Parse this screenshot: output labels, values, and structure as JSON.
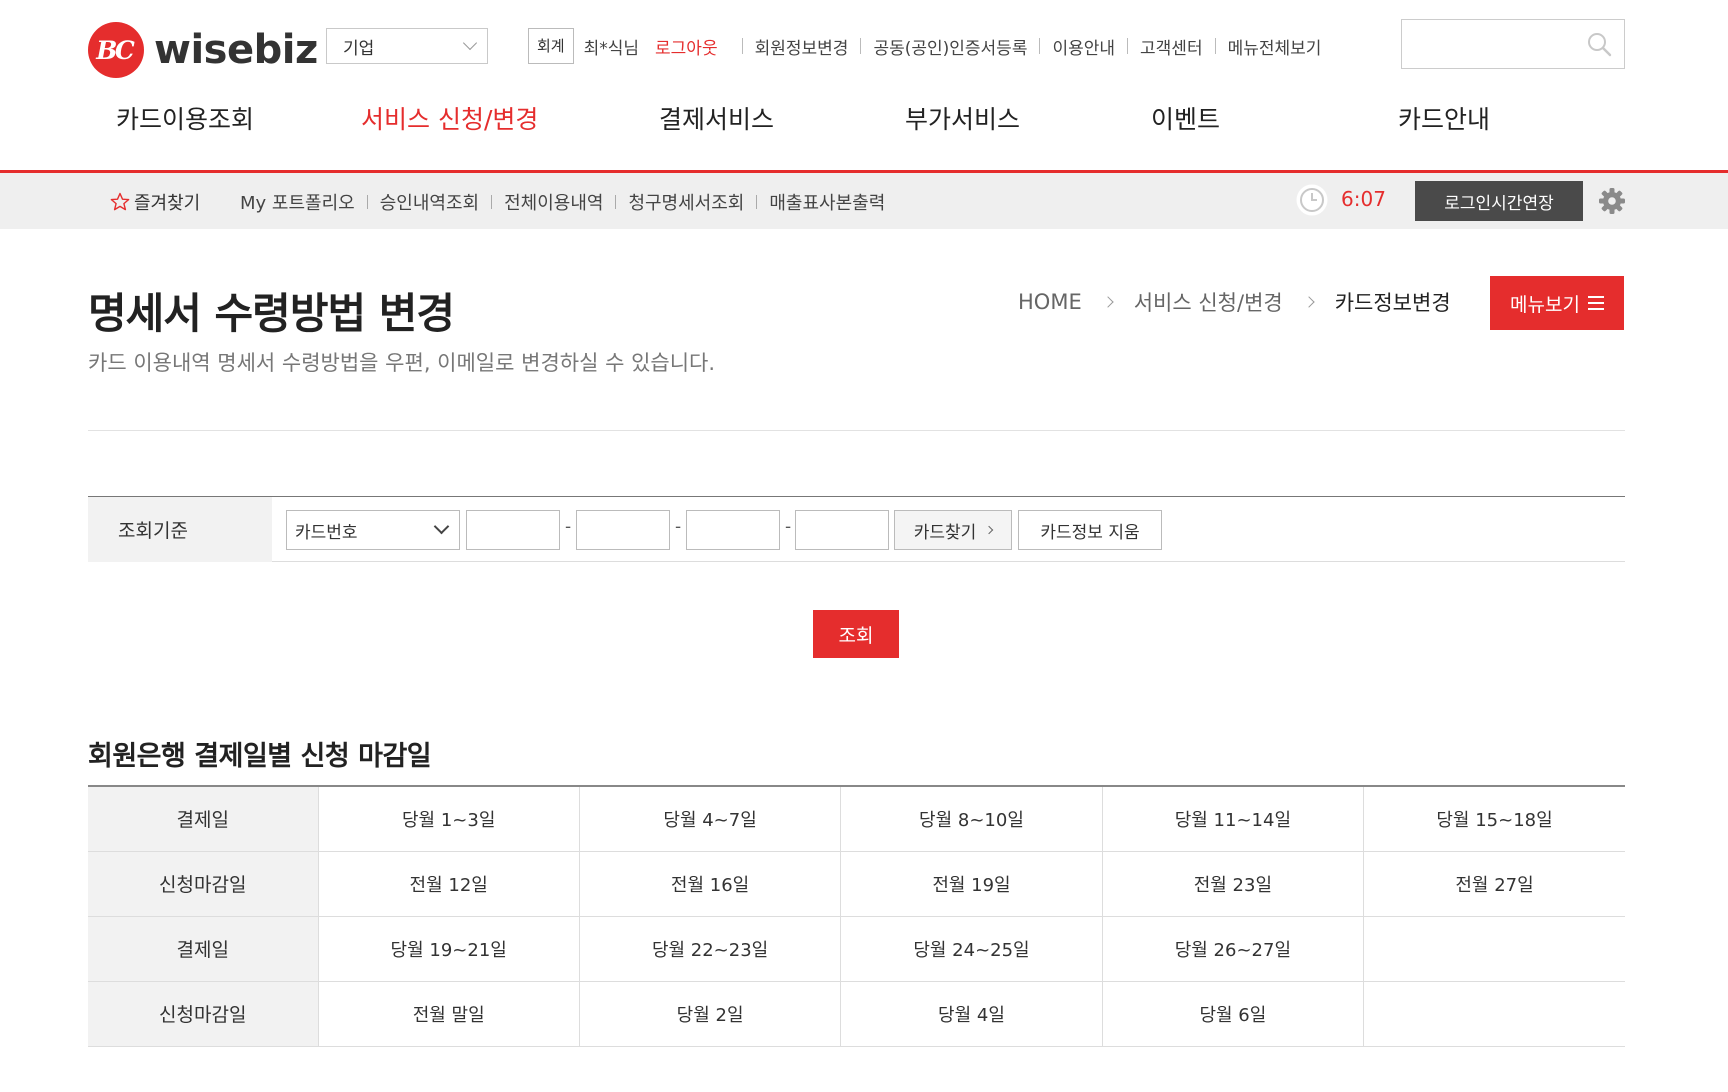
{
  "header": {
    "logo_mark": "BC",
    "logo_text": "wisebiz",
    "company_select": "기업",
    "account_badge": "회계",
    "user_name": "최*식님",
    "util_links": [
      "로그아웃",
      "회원정보변경",
      "공동(공인)인증서등록",
      "이용안내",
      "고객센터",
      "메뉴전체보기"
    ],
    "search_placeholder": ""
  },
  "gnb": {
    "items": [
      {
        "label": "카드이용조회",
        "active": false
      },
      {
        "label": "서비스 신청/변경",
        "active": true
      },
      {
        "label": "결제서비스",
        "active": false
      },
      {
        "label": "부가서비스",
        "active": false
      },
      {
        "label": "이벤트",
        "active": false
      },
      {
        "label": "카드안내",
        "active": false
      }
    ]
  },
  "subbar": {
    "favorites": "즐겨찾기",
    "links": [
      "My 포트폴리오",
      "승인내역조회",
      "전체이용내역",
      "청구명세서조회",
      "매출표사본출력"
    ],
    "timer": "6:07",
    "extend_label": "로그인시간연장"
  },
  "page": {
    "title": "명세서 수령방법 변경",
    "description": "카드 이용내역 명세서 수령방법을 우편, 이메일로 변경하실 수 있습니다.",
    "breadcrumb": [
      "HOME",
      "서비스 신청/변경",
      "카드정보변경"
    ],
    "menu_button": "메뉴보기"
  },
  "form": {
    "label": "조회기준",
    "type_select": "카드번호",
    "card_segments": [
      "",
      "",
      "",
      ""
    ],
    "find_card": "카드찾기",
    "clear_card": "카드정보 지움",
    "search_button": "조회"
  },
  "deadlines": {
    "title": "회원은행 결제일별 신청 마감일",
    "rows": [
      {
        "head": "결제일",
        "cells": [
          "당월 1~3일",
          "당월 4~7일",
          "당월 8~10일",
          "당월 11~14일",
          "당월 15~18일"
        ]
      },
      {
        "head": "신청마감일",
        "cells": [
          "전월 12일",
          "전월 16일",
          "전월 19일",
          "전월 23일",
          "전월 27일"
        ]
      },
      {
        "head": "결제일",
        "cells": [
          "당월 19~21일",
          "당월 22~23일",
          "당월 24~25일",
          "당월 26~27일",
          ""
        ]
      },
      {
        "head": "신청마감일",
        "cells": [
          "전월 말일",
          "당월 2일",
          "당월 4일",
          "당월 6일",
          ""
        ]
      }
    ]
  },
  "colors": {
    "accent": "#e52d2d",
    "dark_button": "#4a4a4a",
    "label_bg": "#f2f2f2"
  }
}
